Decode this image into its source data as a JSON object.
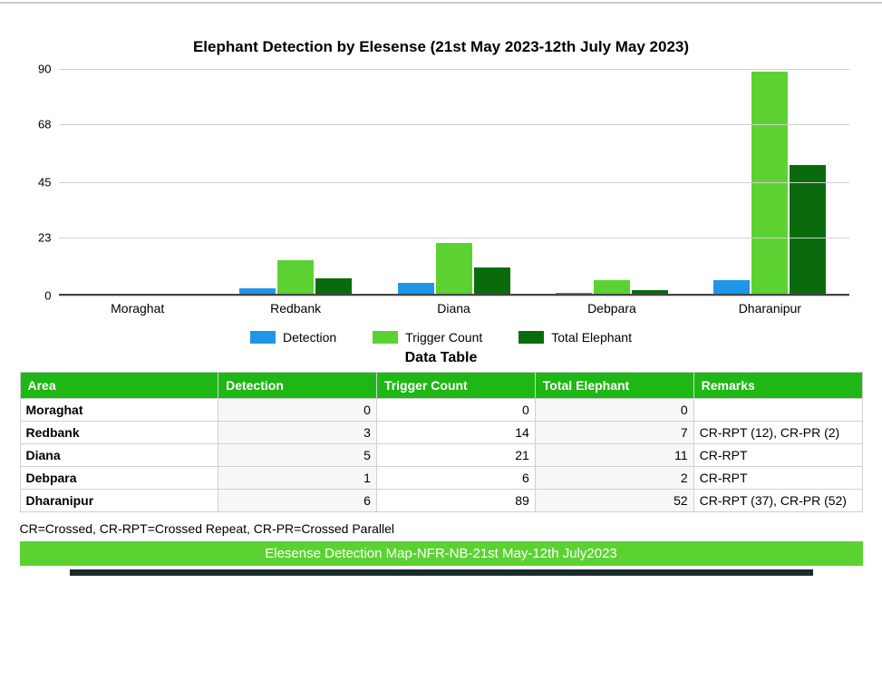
{
  "chart_data": {
    "type": "bar",
    "title": "Elephant Detection by Elesense (21st May 2023-12th July May 2023)",
    "categories": [
      "Moraghat",
      "Redbank",
      "Diana",
      "Debpara",
      "Dharanipur"
    ],
    "series": [
      {
        "name": "Detection",
        "values": [
          0,
          3,
          5,
          1,
          6
        ]
      },
      {
        "name": "Trigger Count",
        "values": [
          0,
          14,
          21,
          6,
          89
        ]
      },
      {
        "name": "Total Elephant",
        "values": [
          0,
          7,
          11,
          2,
          52
        ]
      }
    ],
    "ylim": [
      0,
      90
    ],
    "yticks": [
      0,
      23,
      45,
      68,
      90
    ],
    "xlabel": "",
    "ylabel": ""
  },
  "legend": {
    "detection": "Detection",
    "trigger": "Trigger Count",
    "total": "Total Elephant"
  },
  "table": {
    "title": "Data Table",
    "headers": [
      "Area",
      "Detection",
      "Trigger Count",
      "Total Elephant",
      "Remarks"
    ],
    "rows": [
      {
        "area": "Moraghat",
        "detection": "0",
        "trigger": "0",
        "total": "0",
        "remarks": ""
      },
      {
        "area": "Redbank",
        "detection": "3",
        "trigger": "14",
        "total": "7",
        "remarks": "CR-RPT (12), CR-PR (2)"
      },
      {
        "area": "Diana",
        "detection": "5",
        "trigger": "21",
        "total": "11",
        "remarks": "CR-RPT"
      },
      {
        "area": "Debpara",
        "detection": "1",
        "trigger": "6",
        "total": "2",
        "remarks": "CR-RPT"
      },
      {
        "area": "Dharanipur",
        "detection": "6",
        "trigger": "89",
        "total": "52",
        "remarks": "CR-RPT (37), CR-PR (52)"
      }
    ]
  },
  "abbr_note": "CR=Crossed, CR-RPT=Crossed Repeat, CR-PR=Crossed Parallel",
  "banner": "Elesense Detection Map-NFR-NB-21st May-12th July2023"
}
